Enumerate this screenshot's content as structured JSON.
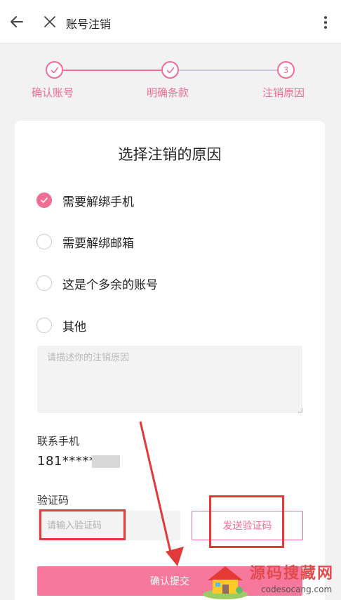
{
  "header": {
    "title": "账号注销"
  },
  "steps": [
    {
      "label": "确认账号",
      "state": "done"
    },
    {
      "label": "明确条款",
      "state": "done"
    },
    {
      "label": "注销原因",
      "number": "3",
      "state": "active"
    }
  ],
  "card": {
    "title": "选择注销的原因",
    "options": [
      {
        "label": "需要解绑手机",
        "checked": true
      },
      {
        "label": "需要解绑邮箱",
        "checked": false
      },
      {
        "label": "这是个多余的账号",
        "checked": false
      },
      {
        "label": "其他",
        "checked": false
      }
    ],
    "reason_placeholder": "请描述你的注销原因",
    "phone_label": "联系手机",
    "phone_value": "181*****",
    "code_label": "验证码",
    "code_placeholder": "请输入验证码",
    "send_code_label": "发送验证码",
    "submit_label": "确认提交"
  },
  "watermark": {
    "main": "源码搜藏网",
    "sub": "codesocang.com"
  },
  "colors": {
    "accent": "#f06d93",
    "annotation": "#e23a3a"
  }
}
